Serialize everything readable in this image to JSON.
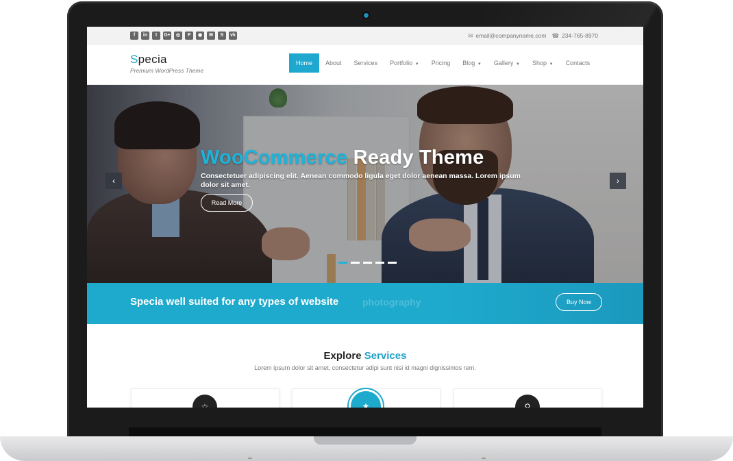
{
  "topbar": {
    "social_icons": [
      "facebook-icon",
      "linkedin-icon",
      "twitter-icon",
      "google-plus-icon",
      "instagram-icon",
      "pinterest-icon",
      "dribbble-icon",
      "skype-alt-icon",
      "skype-icon",
      "vk-icon"
    ],
    "social_glyphs": [
      "f",
      "in",
      "t",
      "G+",
      "◎",
      "P",
      "◉",
      "✉",
      "S",
      "vk"
    ],
    "email": "email@companyname.com",
    "phone": "234-765-8970"
  },
  "brand": {
    "first_letter": "S",
    "rest": "pecia",
    "tagline": "Premium WordPress Theme"
  },
  "menu": {
    "items": [
      {
        "label": "Home",
        "active": true,
        "dropdown": false
      },
      {
        "label": "About",
        "active": false,
        "dropdown": false
      },
      {
        "label": "Services",
        "active": false,
        "dropdown": false
      },
      {
        "label": "Portfolio",
        "active": false,
        "dropdown": true
      },
      {
        "label": "Pricing",
        "active": false,
        "dropdown": false
      },
      {
        "label": "Blog",
        "active": false,
        "dropdown": true
      },
      {
        "label": "Gallery",
        "active": false,
        "dropdown": true
      },
      {
        "label": "Shop",
        "active": false,
        "dropdown": true
      },
      {
        "label": "Contacts",
        "active": false,
        "dropdown": false
      }
    ]
  },
  "hero": {
    "title_accent": "WooCommerce",
    "title_rest": " Ready Theme",
    "text": "Consectetuer adipiscing elit. Aenean commodo ligula eget dolor aenean massa. Lorem ipsum dolor sit amet.",
    "button": "Read More",
    "prev": "‹",
    "next": "›",
    "slides": 5,
    "active_slide": 1
  },
  "callout": {
    "text": "Specia well suited for any types of website",
    "ghost_text": "photography",
    "button": "Buy Now"
  },
  "services": {
    "title_plain": "Explore ",
    "title_accent": "Services",
    "subtitle": "Lorem ipsum dolor sit amet, consectetur adipi sunt nisi id magni dignissimos rem."
  },
  "colors": {
    "accent": "#1ea7cf",
    "frame": "#1b1b1b"
  }
}
